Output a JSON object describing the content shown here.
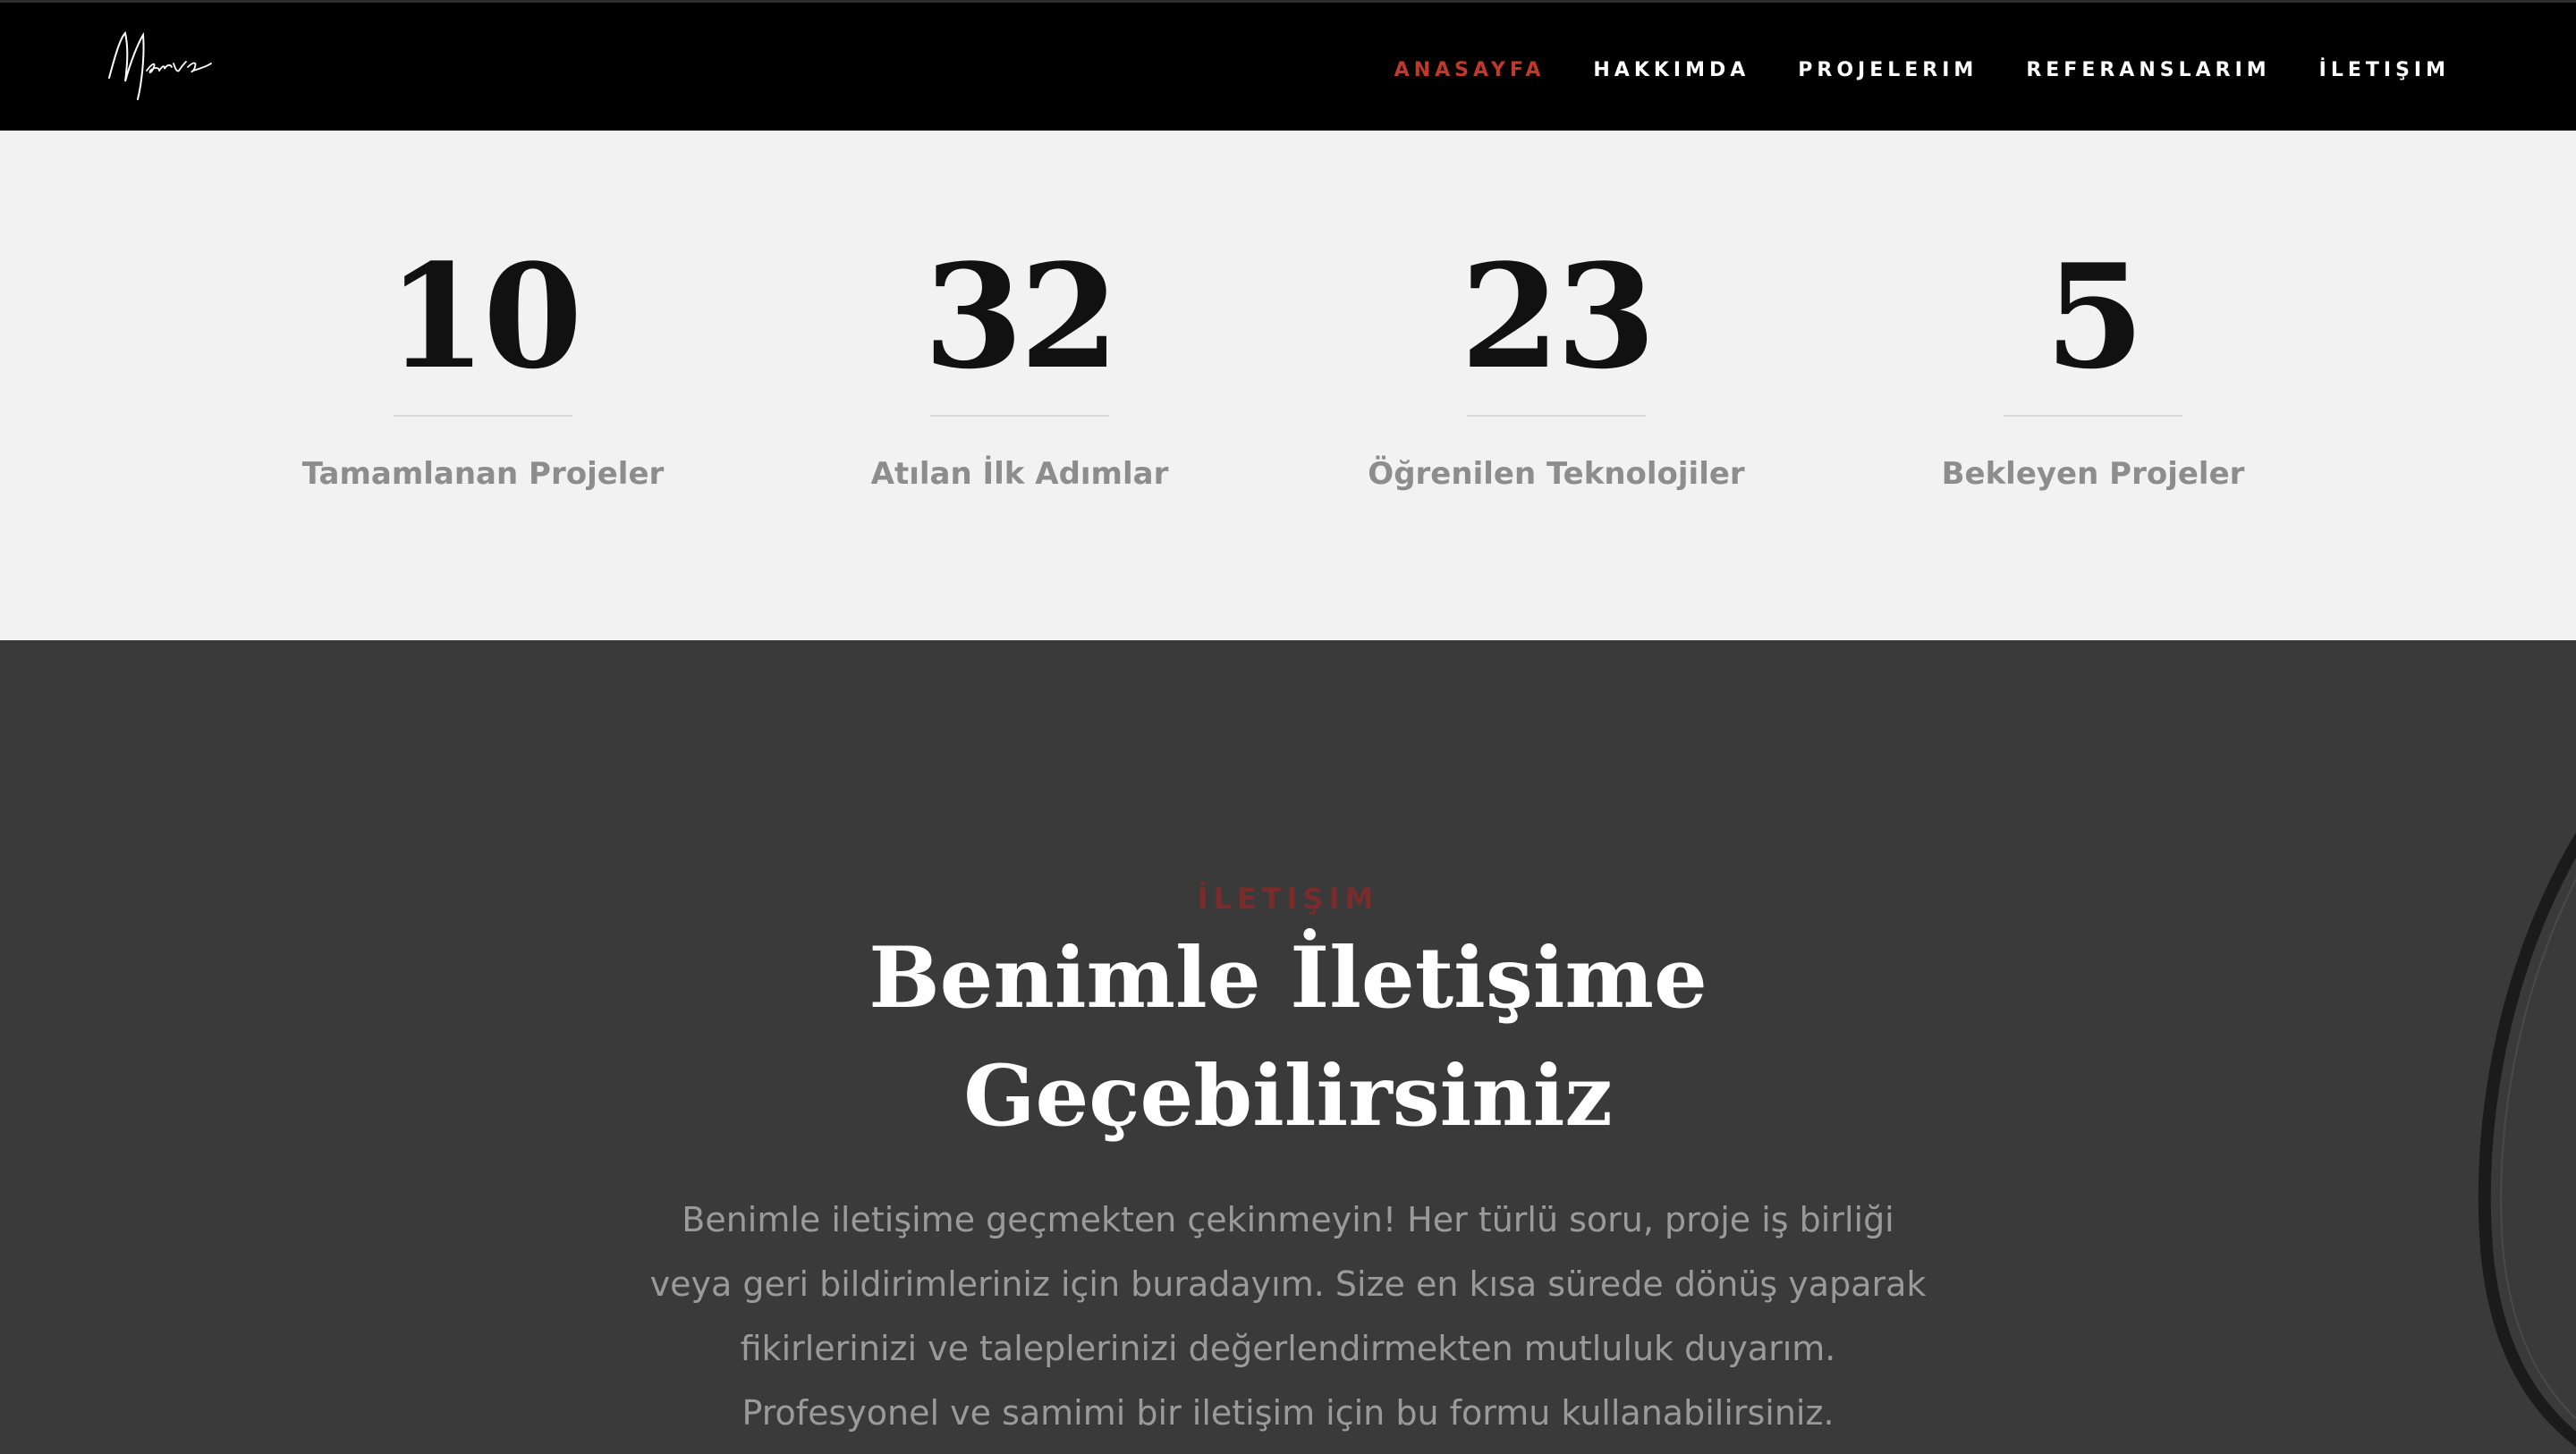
{
  "brand": {
    "logo_text": "Merve"
  },
  "nav": {
    "items": [
      {
        "label": "ANASAYFA",
        "active": true
      },
      {
        "label": "HAKKIMDA",
        "active": false
      },
      {
        "label": "PROJELERIM",
        "active": false
      },
      {
        "label": "REFERANSLARIM",
        "active": false
      },
      {
        "label": "İLETIŞIM",
        "active": false
      }
    ]
  },
  "stats": [
    {
      "value": "10",
      "label": "Tamamlanan Projeler"
    },
    {
      "value": "32",
      "label": "Atılan İlk Adımlar"
    },
    {
      "value": "23",
      "label": "Öğrenilen Teknolojiler"
    },
    {
      "value": "5",
      "label": "Bekleyen Projeler"
    }
  ],
  "contact": {
    "eyebrow": "İLETIŞIM",
    "heading_line1": "Benimle İletişime",
    "heading_line2": "Geçebilirsiniz",
    "description": [
      "Benimle iletişime geçmekten çekinmeyin! Her türlü soru, proje iş birliği",
      "veya geri bildirimleriniz için buradayım. Size en kısa sürede dönüş yaparak",
      "fikirlerinizi ve taleplerinizi değerlendirmekten mutluluk duyarım.",
      "Profesyonel ve samimi bir iletişim için bu formu kullanabilirsiniz."
    ]
  },
  "colors": {
    "navbar_bg": "#000000",
    "nav_active": "#c0392b",
    "nav_text": "#ffffff",
    "stats_bg": "#f2f2f2",
    "stat_number": "#111111",
    "stat_label": "#8d8d8d",
    "contact_bg": "#3a3a3a",
    "contact_eyebrow": "#7a2b2b",
    "contact_heading": "#ffffff",
    "contact_text": "#9a9a9a"
  }
}
